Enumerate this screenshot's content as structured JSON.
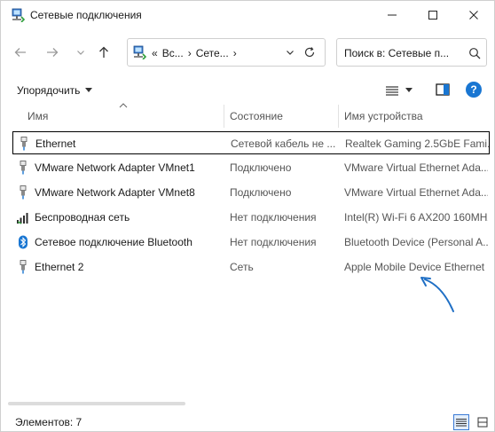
{
  "window": {
    "title": "Сетевые подключения"
  },
  "address": {
    "prefix": "«",
    "crumbs": [
      "Вс...",
      "Сете..."
    ],
    "separator": "›"
  },
  "search": {
    "placeholder": "Поиск в: Сетевые п..."
  },
  "toolbar": {
    "organize_label": "Упорядочить"
  },
  "columns": {
    "name": "Имя",
    "status": "Состояние",
    "device": "Имя устройства"
  },
  "connections": [
    {
      "name": "Ethernet",
      "status": "Сетевой кабель не ...",
      "device": "Realtek Gaming 2.5GbE Fami...",
      "icon": "ethernet-icon",
      "selected": true
    },
    {
      "name": "VMware Network Adapter VMnet1",
      "status": "Подключено",
      "device": "VMware Virtual Ethernet Ada...",
      "icon": "ethernet-icon",
      "selected": false
    },
    {
      "name": "VMware Network Adapter VMnet8",
      "status": "Подключено",
      "device": "VMware Virtual Ethernet Ada...",
      "icon": "ethernet-icon",
      "selected": false
    },
    {
      "name": "Беспроводная сеть",
      "status": "Нет подключения",
      "device": "Intel(R) Wi-Fi 6 AX200 160MHz",
      "icon": "wifi-icon",
      "selected": false
    },
    {
      "name": "Сетевое подключение Bluetooth",
      "status": "Нет подключения",
      "device": "Bluetooth Device (Personal A...",
      "icon": "bluetooth-icon",
      "selected": false
    },
    {
      "name": "Ethernet 2",
      "status": "Сеть",
      "device": "Apple Mobile Device Ethernet",
      "icon": "ethernet-icon",
      "selected": false
    }
  ],
  "statusbar": {
    "count_label": "Элементов: 7"
  },
  "colors": {
    "accent": "#1976d2",
    "annotation_arrow": "#1f6fc5"
  }
}
